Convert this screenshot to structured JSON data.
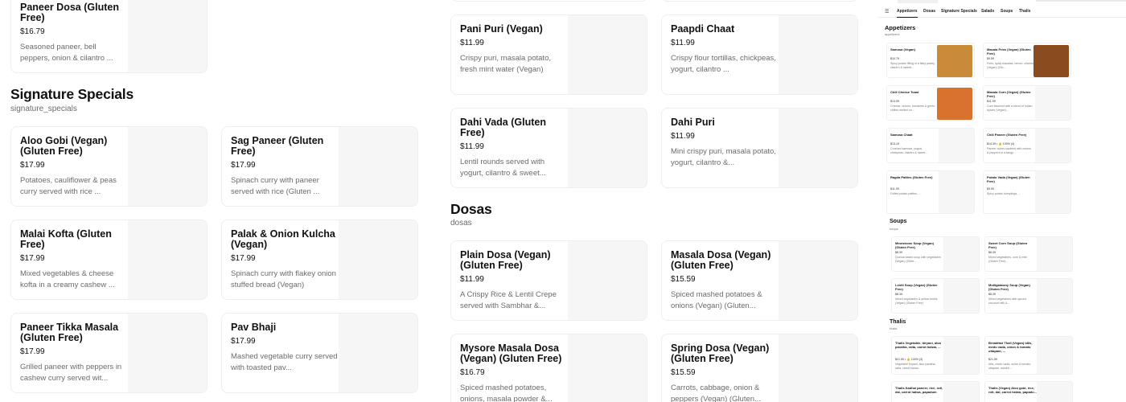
{
  "sections": {
    "signature": {
      "title": "Signature Specials",
      "subtitle": "signature_specials"
    },
    "dosas": {
      "title": "Dosas",
      "subtitle": "dosas"
    }
  },
  "cards": {
    "paneer_dosa": {
      "name": "Paneer Dosa  (Gluten Free)",
      "price": "$16.79",
      "desc": "Seasoned paneer, bell peppers, onion & cilantro ..."
    },
    "aloo_gobi": {
      "name": "Aloo Gobi (Vegan) (Gluten Free)",
      "price": "$17.99",
      "desc": "Potatoes, cauliflower & peas curry served with rice ..."
    },
    "sag_paneer": {
      "name": "Sag Paneer (Gluten Free)",
      "price": "$17.99",
      "desc": "Spinach curry with paneer served with rice (Gluten ..."
    },
    "malai_kofta": {
      "name": "Malai Kofta  (Gluten Free)",
      "price": "$17.99",
      "desc": "Mixed vegetables & cheese kofta in a creamy cashew ..."
    },
    "palak_kulcha": {
      "name": "Palak & Onion Kulcha (Vegan)",
      "price": "$17.99",
      "desc": "Spinach curry with flakey onion stuffed bread (Vegan)"
    },
    "paneer_tikka": {
      "name": "Paneer Tikka Masala (Gluten Free)",
      "price": "$17.99",
      "desc": "Grilled paneer with peppers in cashew curry served wit..."
    },
    "pav_bhaji": {
      "name": "Pav Bhaji",
      "price": "$17.99",
      "desc": "Mashed vegetable curry served with toasted pav..."
    },
    "pani_puri": {
      "name": "Pani Puri (Vegan)",
      "price": "$11.99",
      "desc": "Crispy puri, masala potato, fresh mint water (Vegan)"
    },
    "paapdi_chaat": {
      "name": "Paapdi Chaat",
      "price": "$11.99",
      "desc": "Crispy flour tortillas, chickpeas, yogurt, cilantro ..."
    },
    "dahi_vada": {
      "name": "Dahi Vada (Gluten Free)",
      "price": "$11.99",
      "desc": "Lentil rounds served with yogurt, cilantro & sweet..."
    },
    "dahi_puri": {
      "name": "Dahi Puri",
      "price": "$11.99",
      "desc": "Mini crispy puri, masala potato, yogurt, cilantro &..."
    },
    "plain_dosa": {
      "name": "Plain Dosa (Vegan) (Gluten Free)",
      "price": "$11.99",
      "desc": "A Crispy Rice & Lentil Crepe served with Sambhar &..."
    },
    "masala_dosa": {
      "name": "Masala Dosa (Vegan) (Gluten Free)",
      "price": "$15.59",
      "desc": "Spiced mashed potatoes & onions (Vegan) (Gluten..."
    },
    "mysore_dosa": {
      "name": "Mysore Masala Dosa (Vegan) (Gluten Free)",
      "price": "$16.79",
      "desc": "Spiced mashed potatoes, onions, masala powder &..."
    },
    "spring_dosa": {
      "name": "Spring Dosa (Vegan) (Gluten Free)",
      "price": "$15.59",
      "desc": "Carrots, cabbage, onion & peppers (Vegan) (Gluten..."
    }
  },
  "mini": {
    "tabs": [
      "Appetizers",
      "Dosas",
      "Signature Specials",
      "Salads",
      "Soups",
      "Thalis"
    ],
    "appetizers": {
      "title": "Appetizers",
      "subtitle": "appetizers"
    },
    "soups": {
      "title": "Soups",
      "subtitle": "soups"
    },
    "thalis": {
      "title": "Thalis",
      "subtitle": "thalis"
    },
    "items": {
      "samosa": {
        "name": "Samosa (Vegan)",
        "price": "$10.79",
        "desc": "Spicy potato filling in a flaky pastry, cilantro & sweeti..."
      },
      "masala_fries": {
        "name": "Masala Fries (Vegan) (Gluten Free)",
        "price": "$9.59",
        "desc": "Fries, spicy masalas, lemon, cilantro (Vegan) (Glu..."
      },
      "chili_toast": {
        "name": "Chili Cheese Toast",
        "price": "$13.99",
        "desc": "Cheese, onions, tomatoes & green chilies melted on..."
      },
      "masala_corn": {
        "name": "Masala Corn (Vegan) (Gluten Free)",
        "price": "$11.99",
        "desc": "Corn flavored with a blend of Indian spices (Vegan)..."
      },
      "samosa_chaat": {
        "name": "Samosa Chaat",
        "price": "$13.19",
        "desc": "Crushed samosa, yogurt, chickpeas, cilantro & sweet..."
      },
      "chili_paneer": {
        "name": "Chili Paneer  (Gluten Free)",
        "price": "$14.39 • 👍 100% (4)",
        "desc": "Paneer cubes sautéed with onions & peppers in a tangy..."
      },
      "ragda": {
        "name": "Ragda Patties (Gluten Free)",
        "price": "$11.99",
        "desc": "Grilled potato patties, ..."
      },
      "potato_vada": {
        "name": "Potato Vada (Vegan) (Gluten Free)",
        "price": "$9.59",
        "desc": "Spicy potato dumplings, ..."
      },
      "minestrone": {
        "name": "Minestrone Soup (Vegan) (Gluten Free)",
        "price": "$8.39",
        "desc": "Quinoa based soup with vegetables (Vegan) (Glute..."
      },
      "sweet_corn": {
        "name": "Sweet Corn Soup (Gluten Free)",
        "price": "$8.39",
        "desc": "Mixed vegetables, corn & milk (Gluten Free)..."
      },
      "lentil": {
        "name": "Lentil Soup (Vegan) (Gluten Free)",
        "price": "$8.39",
        "desc": "Mixed vegetables & yellow lentils (Vegan) (Gluten Free)"
      },
      "mulligatawny": {
        "name": "Mulligatawny Soup (Vegan) (Gluten Free)",
        "price": "$8.39",
        "desc": "Mixed vegetables with spiced coconut milk &..."
      },
      "thali_veg": {
        "name": "Thalis Vegetable, biryani, aloo paratha, raita, carrot halwa, ...",
        "price": "$21.59 • 👍 100% (3)",
        "desc": "Vegetable biryani, aloo paratha, raita, carrot halwa..."
      },
      "breakfast_thali": {
        "name": "Breakfast Thali (Vegan) Idlis, medu vada, onion & tomato uttapam, ...",
        "price": "$21.59",
        "desc": "Idlis, medu vada, onion & tomato uttapam, sambh..."
      },
      "kadhai_thali": {
        "name": "Thalis Kadhai paneer, rice, roti, dal, carrot halwa, papadum",
        "price": "",
        "desc": ""
      },
      "aloo_thali": {
        "name": "Thalis (Vegan) Aloo gobi, rice, roti, dal, carrot halwa, papadu...",
        "price": "",
        "desc": ""
      }
    }
  }
}
